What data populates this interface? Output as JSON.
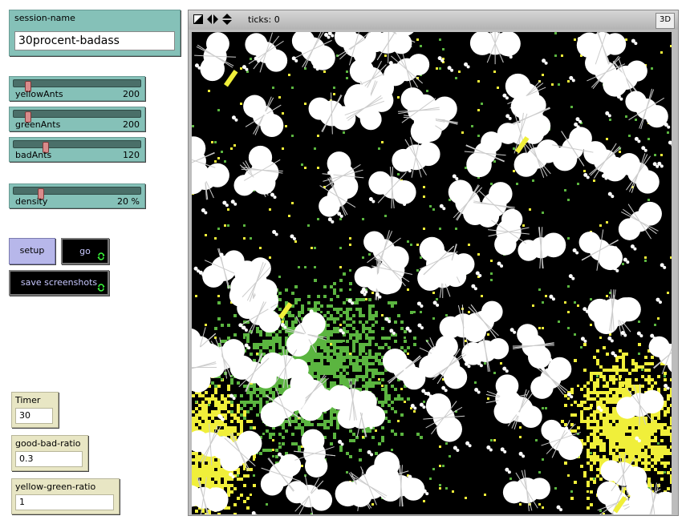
{
  "session_name": {
    "label": "session-name",
    "value": "30procent-badass"
  },
  "sliders": [
    {
      "name": "yellowAnts",
      "value": "200",
      "fraction": 0.17
    },
    {
      "name": "greenAnts",
      "value": "200",
      "fraction": 0.12
    },
    {
      "name": "badAnts",
      "value": "120",
      "fraction": 0.23
    },
    {
      "name": "density",
      "value": "20 %",
      "fraction": 0.2
    }
  ],
  "buttons": {
    "setup": "setup",
    "go": "go",
    "save_screenshots": "save screenshots"
  },
  "monitors": [
    {
      "label": "Timer",
      "value": "30"
    },
    {
      "label": "good-bad-ratio",
      "value": "0.3"
    },
    {
      "label": "yellow-green-ratio",
      "value": "1"
    }
  ],
  "view": {
    "ticks_label": "ticks: 0",
    "three_d_label": "3D"
  },
  "colors": {
    "widget_teal": "#85c1b8",
    "button_purple": "#b7b7ea",
    "monitor_beige": "#e8e6c4",
    "patch_green": "#5bb540",
    "patch_yellow": "#f0ef3a",
    "ant_white": "#ffffff",
    "background_black": "#000000"
  }
}
